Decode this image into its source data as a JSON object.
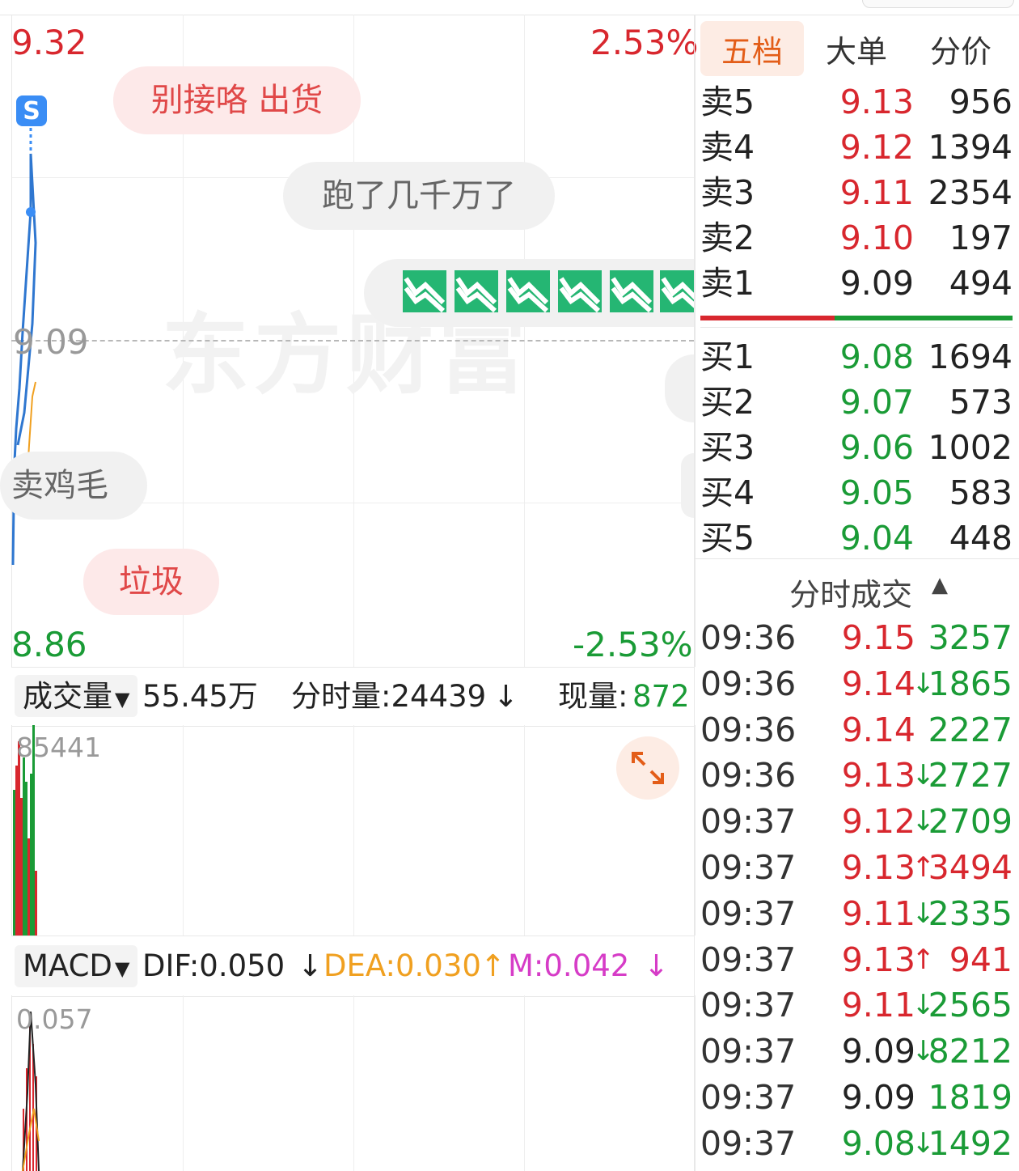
{
  "chart": {
    "high_price": "9.32",
    "high_pct": "2.53%",
    "prev_close": "9.09",
    "low_price": "8.86",
    "low_pct": "-2.53%",
    "watermark": "东方财富",
    "badge": "S",
    "comments": [
      "别接咯 出货",
      "跑了几千万了",
      "卖鸡毛",
      "垃圾"
    ]
  },
  "volume": {
    "selector": "成交量",
    "total": "55.45万",
    "minute_label": "分时量:24439",
    "minute_arrow": "↓",
    "current_label": "现量:",
    "current_value": "872",
    "max_label": "85441"
  },
  "macd": {
    "selector": "MACD",
    "dif": "DIF:0.050",
    "dif_arrow": "↓",
    "dea": "DEA:0.030",
    "dea_arrow": "↑",
    "m": "M:0.042",
    "m_arrow": "↓",
    "max_label": "0.057",
    "colors": {
      "dif": "#222222",
      "dea": "#f0a020",
      "m": "#d63cc7"
    }
  },
  "tabs": [
    "五档",
    "大单",
    "分价"
  ],
  "order_book": {
    "sell": [
      {
        "label": "卖5",
        "price": "9.13",
        "volume": "956"
      },
      {
        "label": "卖4",
        "price": "9.12",
        "volume": "1394"
      },
      {
        "label": "卖3",
        "price": "9.11",
        "volume": "2354"
      },
      {
        "label": "卖2",
        "price": "9.10",
        "volume": "197"
      },
      {
        "label": "卖1",
        "price": "9.09",
        "volume": "494"
      }
    ],
    "buy": [
      {
        "label": "买1",
        "price": "9.08",
        "volume": "1694"
      },
      {
        "label": "买2",
        "price": "9.07",
        "volume": "573"
      },
      {
        "label": "买3",
        "price": "9.06",
        "volume": "1002"
      },
      {
        "label": "买4",
        "price": "9.05",
        "volume": "583"
      },
      {
        "label": "买5",
        "price": "9.04",
        "volume": "448"
      }
    ],
    "sell_ratio": 0.43
  },
  "trades": {
    "title": "分时成交",
    "rows": [
      {
        "time": "09:36",
        "price": "9.15",
        "arrow": "",
        "volume": "3257"
      },
      {
        "time": "09:36",
        "price": "9.14",
        "arrow": "↓",
        "volume": "1865"
      },
      {
        "time": "09:36",
        "price": "9.14",
        "arrow": "",
        "volume": "2227"
      },
      {
        "time": "09:36",
        "price": "9.13",
        "arrow": "↓",
        "volume": "2727"
      },
      {
        "time": "09:37",
        "price": "9.12",
        "arrow": "↓",
        "volume": "2709"
      },
      {
        "time": "09:37",
        "price": "9.13",
        "arrow": "↑",
        "volume": "3494"
      },
      {
        "time": "09:37",
        "price": "9.11",
        "arrow": "↓",
        "volume": "2335"
      },
      {
        "time": "09:37",
        "price": "9.13",
        "arrow": "↑",
        "volume": "941"
      },
      {
        "time": "09:37",
        "price": "9.11",
        "arrow": "↓",
        "volume": "2565"
      },
      {
        "time": "09:37",
        "price": "9.09",
        "arrow": "↓",
        "volume": "8212"
      },
      {
        "time": "09:37",
        "price": "9.09",
        "arrow": "",
        "volume": "1819"
      },
      {
        "time": "09:37",
        "price": "9.08",
        "arrow": "↓",
        "volume": "1492"
      }
    ]
  },
  "colors": {
    "up": "#d8272e",
    "down": "#1a9b36",
    "neutral": "#222222",
    "accent": "#e35d18"
  }
}
